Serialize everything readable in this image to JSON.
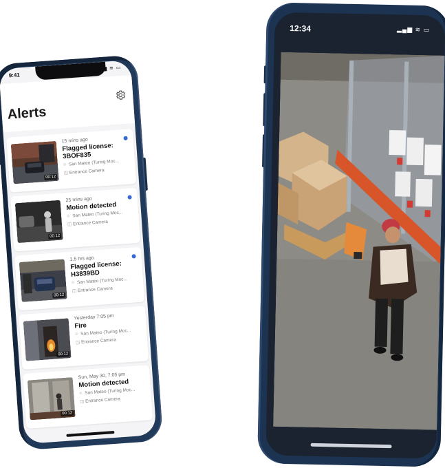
{
  "phone_left": {
    "status_time": "9:41",
    "status_icons": "▂▄▆ ≋ ▭",
    "title": "Alerts",
    "alerts": [
      {
        "time": "15 mins ago",
        "title": "Flagged license: 3BOF835",
        "location": "San Mateo (Turing Moc...",
        "camera": "Entrance Camera",
        "stamp": "00:12",
        "unread": true
      },
      {
        "time": "25 mins ago",
        "title": "Motion detected",
        "location": "San Mateo (Turing Moc...",
        "camera": "Entrance Camera",
        "stamp": "00:12",
        "unread": true
      },
      {
        "time": "1.5 hrs ago",
        "title": "Flagged license: H3839BD",
        "location": "San Mateo (Turing Moc...",
        "camera": "Entrance Camera",
        "stamp": "00:12",
        "unread": true
      },
      {
        "time": "Yesterday 7:05 pm",
        "title": "Fire",
        "location": "San Mateo (Turing Moc...",
        "camera": "Entrance Camera",
        "stamp": "00:12",
        "unread": false
      },
      {
        "time": "Sun, May 30, 7:05 pm",
        "title": "Motion detected",
        "location": "San Mateo (Turing Moc...",
        "camera": "Entrance Camera",
        "stamp": "00:12",
        "unread": false
      }
    ]
  },
  "phone_right": {
    "status_time": "12:34",
    "status_icons": "▂▄▆ ≋ ▭"
  }
}
